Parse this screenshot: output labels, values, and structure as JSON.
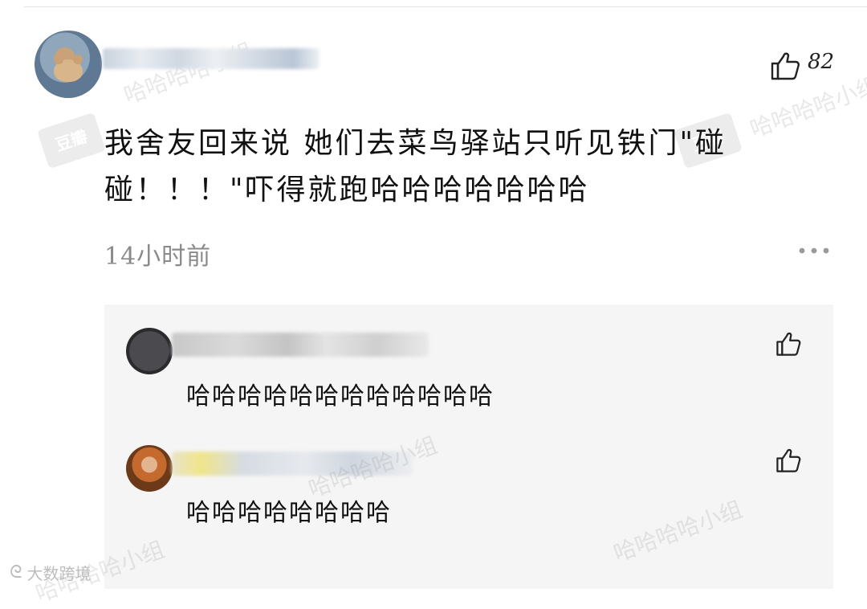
{
  "main_comment": {
    "likes": "82",
    "text": "我舍友回来说 她们去菜鸟驿站只听见铁门\"碰碰！！！\"吓得就跑哈哈哈哈哈哈哈",
    "timestamp": "14小时前"
  },
  "replies": [
    {
      "text": "哈哈哈哈哈哈哈哈哈哈哈哈"
    },
    {
      "text": "哈哈哈哈哈哈哈哈"
    }
  ],
  "watermarks": {
    "badge": "豆瓣",
    "pattern": "哈哈哈哈小组"
  },
  "source": {
    "logo": "ᘓ",
    "label": "大数跨境"
  },
  "icons": {
    "like": "thumbs-up-icon",
    "more": "more-dots-icon"
  }
}
